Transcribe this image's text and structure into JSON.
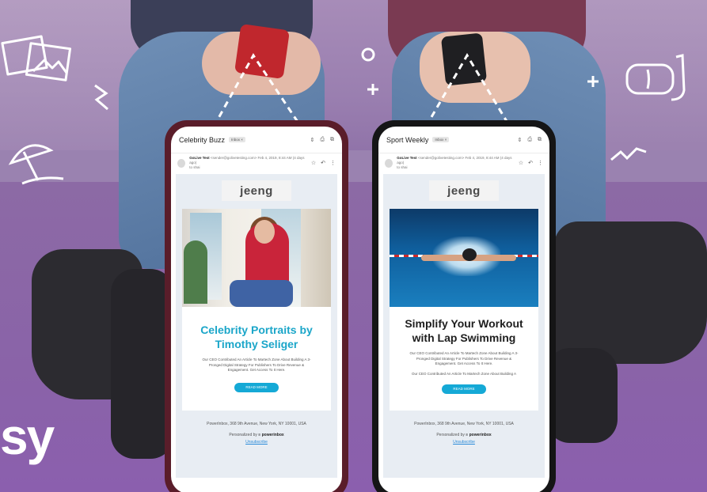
{
  "brand": {
    "text": "sy"
  },
  "phones": [
    {
      "subject": "Celebrity Buzz",
      "inbox_badge": "Inbox ×",
      "sender": {
        "name": "GoLive Test",
        "meta": "<sender@golivetesting.com> Feb 4, 2019, 8:44 AM (4 days ago)",
        "to": "to shai"
      },
      "logo": "jeeng",
      "title": "Celebrity Portraits by Timothy Seliger",
      "text": "Our CEO Contributed An Article To Martech Zone About Building A 3-Pronged Digital Strategy For Publishers To Drive Revenue & Engagement. Get Access To It Here.",
      "text2": "",
      "button": "READ MORE",
      "address": "PowerInbox, 368 9th Avenue, New York, NY 10001, USA",
      "personalized_by": "Personalized by",
      "personalized_brand": "≡ powerinbox",
      "unsubscribe": "Unsubscribe"
    },
    {
      "subject": "Sport Weekly",
      "inbox_badge": "Inbox ×",
      "sender": {
        "name": "GoLive Test",
        "meta": "<sender@golivetesting.com> Feb 4, 2019, 8:44 AM (4 days ago)",
        "to": "to shai"
      },
      "logo": "jeeng",
      "title": "Simplify Your Workout with Lap Swimming",
      "text": "Our CEO Contributed An Article To Martech Zone About Building A 3-Pronged Digital Strategy For Publishers To Drive Revenue & Engagement. Get Access To It Here.",
      "text2": "Our CEO Contributed An Article To Martech Zone About Building A",
      "button": "READ MORE",
      "address": "PowerInbox, 368 9th Avenue, New York, NY 10001, USA",
      "personalized_by": "Personalized by",
      "personalized_brand": "≡ powerinbox",
      "unsubscribe": "Unsubscribe"
    }
  ],
  "colors": {
    "background": "#8d6aa6",
    "accent": "#1ba6c9",
    "button": "#15a9d6"
  }
}
